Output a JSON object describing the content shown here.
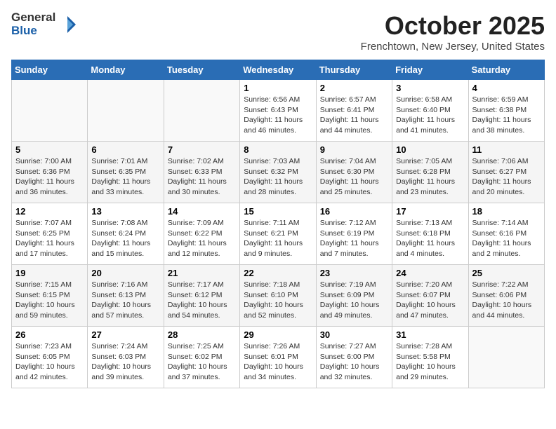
{
  "logo": {
    "general": "General",
    "blue": "Blue"
  },
  "header": {
    "month": "October 2025",
    "location": "Frenchtown, New Jersey, United States"
  },
  "days_of_week": [
    "Sunday",
    "Monday",
    "Tuesday",
    "Wednesday",
    "Thursday",
    "Friday",
    "Saturday"
  ],
  "weeks": [
    [
      {
        "day": "",
        "info": ""
      },
      {
        "day": "",
        "info": ""
      },
      {
        "day": "",
        "info": ""
      },
      {
        "day": "1",
        "info": "Sunrise: 6:56 AM\nSunset: 6:43 PM\nDaylight: 11 hours and 46 minutes."
      },
      {
        "day": "2",
        "info": "Sunrise: 6:57 AM\nSunset: 6:41 PM\nDaylight: 11 hours and 44 minutes."
      },
      {
        "day": "3",
        "info": "Sunrise: 6:58 AM\nSunset: 6:40 PM\nDaylight: 11 hours and 41 minutes."
      },
      {
        "day": "4",
        "info": "Sunrise: 6:59 AM\nSunset: 6:38 PM\nDaylight: 11 hours and 38 minutes."
      }
    ],
    [
      {
        "day": "5",
        "info": "Sunrise: 7:00 AM\nSunset: 6:36 PM\nDaylight: 11 hours and 36 minutes."
      },
      {
        "day": "6",
        "info": "Sunrise: 7:01 AM\nSunset: 6:35 PM\nDaylight: 11 hours and 33 minutes."
      },
      {
        "day": "7",
        "info": "Sunrise: 7:02 AM\nSunset: 6:33 PM\nDaylight: 11 hours and 30 minutes."
      },
      {
        "day": "8",
        "info": "Sunrise: 7:03 AM\nSunset: 6:32 PM\nDaylight: 11 hours and 28 minutes."
      },
      {
        "day": "9",
        "info": "Sunrise: 7:04 AM\nSunset: 6:30 PM\nDaylight: 11 hours and 25 minutes."
      },
      {
        "day": "10",
        "info": "Sunrise: 7:05 AM\nSunset: 6:28 PM\nDaylight: 11 hours and 23 minutes."
      },
      {
        "day": "11",
        "info": "Sunrise: 7:06 AM\nSunset: 6:27 PM\nDaylight: 11 hours and 20 minutes."
      }
    ],
    [
      {
        "day": "12",
        "info": "Sunrise: 7:07 AM\nSunset: 6:25 PM\nDaylight: 11 hours and 17 minutes."
      },
      {
        "day": "13",
        "info": "Sunrise: 7:08 AM\nSunset: 6:24 PM\nDaylight: 11 hours and 15 minutes."
      },
      {
        "day": "14",
        "info": "Sunrise: 7:09 AM\nSunset: 6:22 PM\nDaylight: 11 hours and 12 minutes."
      },
      {
        "day": "15",
        "info": "Sunrise: 7:11 AM\nSunset: 6:21 PM\nDaylight: 11 hours and 9 minutes."
      },
      {
        "day": "16",
        "info": "Sunrise: 7:12 AM\nSunset: 6:19 PM\nDaylight: 11 hours and 7 minutes."
      },
      {
        "day": "17",
        "info": "Sunrise: 7:13 AM\nSunset: 6:18 PM\nDaylight: 11 hours and 4 minutes."
      },
      {
        "day": "18",
        "info": "Sunrise: 7:14 AM\nSunset: 6:16 PM\nDaylight: 11 hours and 2 minutes."
      }
    ],
    [
      {
        "day": "19",
        "info": "Sunrise: 7:15 AM\nSunset: 6:15 PM\nDaylight: 10 hours and 59 minutes."
      },
      {
        "day": "20",
        "info": "Sunrise: 7:16 AM\nSunset: 6:13 PM\nDaylight: 10 hours and 57 minutes."
      },
      {
        "day": "21",
        "info": "Sunrise: 7:17 AM\nSunset: 6:12 PM\nDaylight: 10 hours and 54 minutes."
      },
      {
        "day": "22",
        "info": "Sunrise: 7:18 AM\nSunset: 6:10 PM\nDaylight: 10 hours and 52 minutes."
      },
      {
        "day": "23",
        "info": "Sunrise: 7:19 AM\nSunset: 6:09 PM\nDaylight: 10 hours and 49 minutes."
      },
      {
        "day": "24",
        "info": "Sunrise: 7:20 AM\nSunset: 6:07 PM\nDaylight: 10 hours and 47 minutes."
      },
      {
        "day": "25",
        "info": "Sunrise: 7:22 AM\nSunset: 6:06 PM\nDaylight: 10 hours and 44 minutes."
      }
    ],
    [
      {
        "day": "26",
        "info": "Sunrise: 7:23 AM\nSunset: 6:05 PM\nDaylight: 10 hours and 42 minutes."
      },
      {
        "day": "27",
        "info": "Sunrise: 7:24 AM\nSunset: 6:03 PM\nDaylight: 10 hours and 39 minutes."
      },
      {
        "day": "28",
        "info": "Sunrise: 7:25 AM\nSunset: 6:02 PM\nDaylight: 10 hours and 37 minutes."
      },
      {
        "day": "29",
        "info": "Sunrise: 7:26 AM\nSunset: 6:01 PM\nDaylight: 10 hours and 34 minutes."
      },
      {
        "day": "30",
        "info": "Sunrise: 7:27 AM\nSunset: 6:00 PM\nDaylight: 10 hours and 32 minutes."
      },
      {
        "day": "31",
        "info": "Sunrise: 7:28 AM\nSunset: 5:58 PM\nDaylight: 10 hours and 29 minutes."
      },
      {
        "day": "",
        "info": ""
      }
    ]
  ]
}
